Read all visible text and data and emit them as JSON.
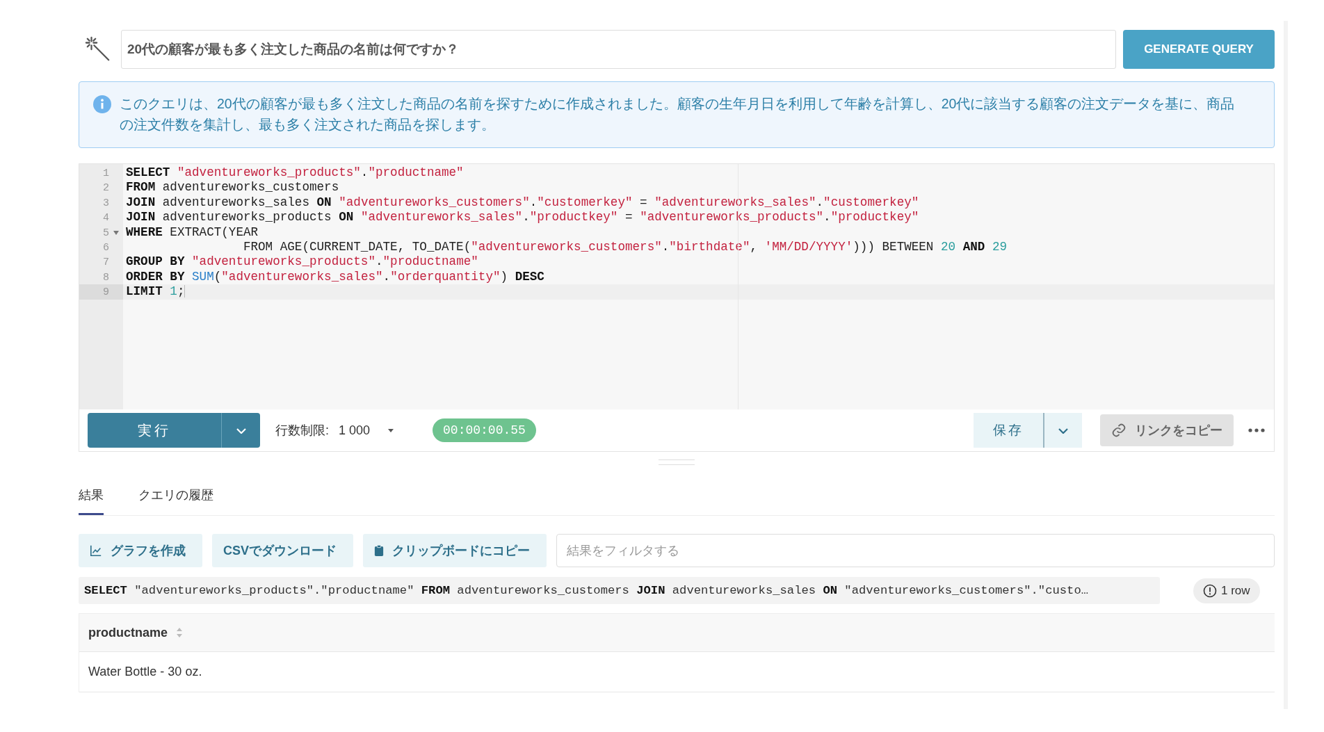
{
  "question": {
    "value": "20代の顧客が最も多く注文した商品の名前は何ですか？",
    "button": "GENERATE QUERY"
  },
  "info": {
    "text": "このクエリは、20代の顧客が最も多く注文した商品の名前を探すために作成されました。顧客の生年月日を利用して年齢を計算し、20代に該当する顧客の注文データを基に、商品の注文件数を集計し、最も多く注文された商品を探します。"
  },
  "editor": {
    "lines": [
      {
        "number": "1",
        "foldable": false,
        "current": false,
        "tokens": [
          {
            "kind": "keyword",
            "text": "SELECT "
          },
          {
            "kind": "string",
            "text": "\"adventureworks_products\""
          },
          {
            "kind": "plain",
            "text": "."
          },
          {
            "kind": "string",
            "text": "\"productname\""
          }
        ]
      },
      {
        "number": "2",
        "foldable": false,
        "current": false,
        "tokens": [
          {
            "kind": "keyword",
            "text": "FROM "
          },
          {
            "kind": "plain",
            "text": "adventureworks_customers"
          }
        ]
      },
      {
        "number": "3",
        "foldable": false,
        "current": false,
        "tokens": [
          {
            "kind": "keyword",
            "text": "JOIN "
          },
          {
            "kind": "plain",
            "text": "adventureworks_sales "
          },
          {
            "kind": "keyword",
            "text": "ON "
          },
          {
            "kind": "string",
            "text": "\"adventureworks_customers\""
          },
          {
            "kind": "plain",
            "text": "."
          },
          {
            "kind": "string",
            "text": "\"customerkey\""
          },
          {
            "kind": "plain",
            "text": " = "
          },
          {
            "kind": "string",
            "text": "\"adventureworks_sales\""
          },
          {
            "kind": "plain",
            "text": "."
          },
          {
            "kind": "string",
            "text": "\"customerkey\""
          }
        ]
      },
      {
        "number": "4",
        "foldable": false,
        "current": false,
        "tokens": [
          {
            "kind": "keyword",
            "text": "JOIN "
          },
          {
            "kind": "plain",
            "text": "adventureworks_products "
          },
          {
            "kind": "keyword",
            "text": "ON "
          },
          {
            "kind": "string",
            "text": "\"adventureworks_sales\""
          },
          {
            "kind": "plain",
            "text": "."
          },
          {
            "kind": "string",
            "text": "\"productkey\""
          },
          {
            "kind": "plain",
            "text": " = "
          },
          {
            "kind": "string",
            "text": "\"adventureworks_products\""
          },
          {
            "kind": "plain",
            "text": "."
          },
          {
            "kind": "string",
            "text": "\"productkey\""
          }
        ]
      },
      {
        "number": "5",
        "foldable": true,
        "current": false,
        "tokens": [
          {
            "kind": "keyword",
            "text": "WHERE "
          },
          {
            "kind": "plain",
            "text": "EXTRACT(YEAR"
          }
        ]
      },
      {
        "number": "6",
        "foldable": false,
        "current": false,
        "tokens": [
          {
            "kind": "plain",
            "text": "                FROM AGE(CURRENT_DATE, TO_DATE("
          },
          {
            "kind": "string",
            "text": "\"adventureworks_customers\""
          },
          {
            "kind": "plain",
            "text": "."
          },
          {
            "kind": "string",
            "text": "\"birthdate\""
          },
          {
            "kind": "plain",
            "text": ", "
          },
          {
            "kind": "string",
            "text": "'MM/DD/YYYY'"
          },
          {
            "kind": "plain",
            "text": "))) BETWEEN "
          },
          {
            "kind": "number",
            "text": "20"
          },
          {
            "kind": "keyword",
            "text": " AND "
          },
          {
            "kind": "number",
            "text": "29"
          }
        ]
      },
      {
        "number": "7",
        "foldable": false,
        "current": false,
        "tokens": [
          {
            "kind": "keyword",
            "text": "GROUP BY "
          },
          {
            "kind": "string",
            "text": "\"adventureworks_products\""
          },
          {
            "kind": "plain",
            "text": "."
          },
          {
            "kind": "string",
            "text": "\"productname\""
          }
        ]
      },
      {
        "number": "8",
        "foldable": false,
        "current": false,
        "tokens": [
          {
            "kind": "keyword",
            "text": "ORDER BY "
          },
          {
            "kind": "function",
            "text": "SUM"
          },
          {
            "kind": "plain",
            "text": "("
          },
          {
            "kind": "string",
            "text": "\"adventureworks_sales\""
          },
          {
            "kind": "plain",
            "text": "."
          },
          {
            "kind": "string",
            "text": "\"orderquantity\""
          },
          {
            "kind": "plain",
            "text": ") "
          },
          {
            "kind": "keyword",
            "text": "DESC"
          }
        ]
      },
      {
        "number": "9",
        "foldable": false,
        "current": true,
        "tokens": [
          {
            "kind": "keyword",
            "text": "LIMIT "
          },
          {
            "kind": "number",
            "text": "1"
          },
          {
            "kind": "plain",
            "text": ";"
          }
        ]
      }
    ]
  },
  "toolbar": {
    "run": "実行",
    "row_limit_label": "行数制限:",
    "row_limit_value": "1 000",
    "timer": "00:00:00.55",
    "save": "保存",
    "copy_link": "リンクをコピー"
  },
  "tabs": [
    {
      "label": "結果",
      "selected": true
    },
    {
      "label": "クエリの履歴",
      "selected": false
    }
  ],
  "actions": [
    {
      "kind": "chart",
      "label": "グラフを作成"
    },
    {
      "kind": "plain",
      "label": "CSVでダウンロード"
    },
    {
      "kind": "clipboard",
      "label": "クリップボードにコピー"
    }
  ],
  "filter": {
    "placeholder": "結果をフィルタする"
  },
  "sql_preview": {
    "tokens": [
      {
        "kind": "keyword",
        "text": "SELECT "
      },
      {
        "kind": "plain",
        "text": "\"adventureworks_products\".\"productname\" "
      },
      {
        "kind": "keyword",
        "text": "FROM "
      },
      {
        "kind": "plain",
        "text": "adventureworks_customers "
      },
      {
        "kind": "keyword",
        "text": "JOIN "
      },
      {
        "kind": "plain",
        "text": "adventureworks_sales "
      },
      {
        "kind": "keyword",
        "text": "ON "
      },
      {
        "kind": "plain",
        "text": "\"adventureworks_customers\".\"custo…"
      }
    ]
  },
  "row_count": "1 row",
  "table": {
    "columns": [
      "productname"
    ],
    "rows": [
      [
        "Water Bottle - 30 oz."
      ]
    ]
  }
}
